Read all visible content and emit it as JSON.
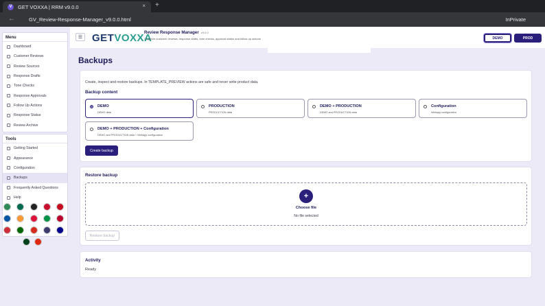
{
  "browser": {
    "tab_title": "GET VOXXA | RRM v9.0.0",
    "tab_close": "×",
    "new_tab": "+",
    "url": "GV_Review-Response-Manager_v9.0.0.html",
    "mode": "InPrivate"
  },
  "header": {
    "logo_text_1": "GET",
    "logo_text_2": "VOXXA",
    "app_title": "Review Response Manager",
    "app_version": "v9.0.0",
    "app_subtitle": "Organize customer reviews, response drafts, tone checks, approval status and follow-up actions",
    "env_demo": "DEMO",
    "env_prod": "PROD"
  },
  "sidebar": {
    "menu_heading": "Menu",
    "menu_items": [
      {
        "label": "Dashboard"
      },
      {
        "label": "Customer Reviews"
      },
      {
        "label": "Review Sources"
      },
      {
        "label": "Response Drafts"
      },
      {
        "label": "Tone Checks"
      },
      {
        "label": "Response Approvals"
      },
      {
        "label": "Follow Up Actions"
      },
      {
        "label": "Response Status"
      },
      {
        "label": "Review Archive"
      }
    ],
    "tools_heading": "Tools",
    "tools_items": [
      {
        "label": "Getting Started"
      },
      {
        "label": "Appearance"
      },
      {
        "label": "Configuration"
      },
      {
        "label": "Backups",
        "active": true
      },
      {
        "label": "Frequently Asked Questions"
      },
      {
        "label": "Help"
      }
    ],
    "flag_colors": [
      [
        "#2e8b57",
        "#006a4e",
        "#222222",
        "#c8102e",
        "#c60b1e"
      ],
      [
        "#0055a4",
        "#ff9933",
        "#dc143c",
        "#009246",
        "#bc002d"
      ],
      [
        "#cd2e3a",
        "#006600",
        "#d52b1e",
        "#3c3b6e",
        "#00008b"
      ],
      [
        "#01411c",
        "#de2910"
      ]
    ]
  },
  "main": {
    "page_title": "Backups",
    "intro": "Create, inspect and restore backups. In TEMPLATE_PREVIEW actions are safe and never write product data.",
    "backup_content_heading": "Backup content",
    "options": [
      {
        "title": "DEMO",
        "desc": "DEMO data",
        "selected": true
      },
      {
        "title": "PRODUCTION",
        "desc": "PRODUCTION data",
        "selected": false
      },
      {
        "title": "DEMO + PRODUCTION",
        "desc": "DEMO and PRODUCTION data",
        "selected": false
      },
      {
        "title": "Configuration",
        "desc": "Webapp configuration",
        "selected": false
      },
      {
        "title": "DEMO + PRODUCTION + Configuration",
        "desc": "DEMO and PRODUCTION data + Webapp configuration",
        "selected": false
      }
    ],
    "create_button": "Create backup",
    "restore_heading": "Restore backup",
    "plus": "+",
    "choose_file": "Choose file",
    "no_file": "No file selected",
    "restore_button": "Restore backup",
    "activity_heading": "Activity",
    "activity_status": "Ready"
  }
}
